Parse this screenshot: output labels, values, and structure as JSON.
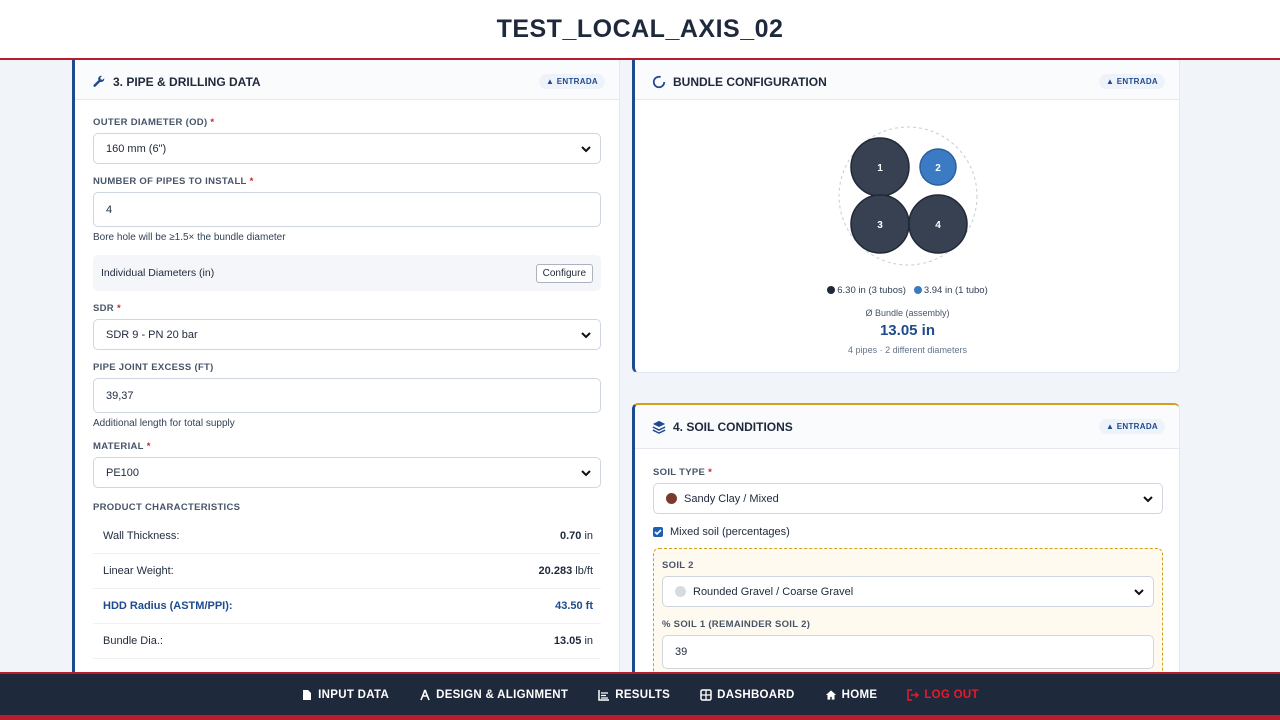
{
  "header": {
    "title": "TEST_LOCAL_AXIS_02"
  },
  "pipe": {
    "title": "3. PIPE & DRILLING DATA",
    "badge": "ENTRADA",
    "od_label": "OUTER DIAMETER (OD)",
    "od_value": "160 mm (6\")",
    "num_label": "NUMBER OF PIPES TO INSTALL",
    "num_value": "4",
    "num_help": "Bore hole will be ≥1.5× the bundle diameter",
    "indiv_label": "Individual Diameters (in)",
    "configure_label": "Configure",
    "sdr_label": "SDR",
    "sdr_value": "SDR 9 - PN 20 bar",
    "joint_label": "PIPE JOINT EXCESS (FT)",
    "joint_value": "39,37",
    "joint_help": "Additional length for total supply",
    "material_label": "MATERIAL",
    "material_value": "PE100",
    "char_title": "PRODUCT CHARACTERISTICS",
    "chars": [
      {
        "label": "Wall Thickness:",
        "value": "0.70",
        "unit": "in",
        "accent": false
      },
      {
        "label": "Linear Weight:",
        "value": "20.283",
        "unit": "lb/ft",
        "accent": false
      },
      {
        "label": "HDD Radius (ASTM/PPI):",
        "value": "43.50",
        "unit": "ft",
        "accent": true
      },
      {
        "label": "Bundle Dia.:",
        "value": "13.05",
        "unit": "in",
        "accent": false
      }
    ]
  },
  "bundle": {
    "title": "BUNDLE CONFIGURATION",
    "badge": "ENTRADA",
    "pipes": [
      "1",
      "2",
      "3",
      "4"
    ],
    "legend_dark": "6.30 in (3 tubos)",
    "legend_blue": "3.94 in (1 tubo)",
    "caption": "Ø Bundle (assembly)",
    "value": "13.05 in",
    "sub": "4 pipes · 2 different diameters",
    "colors": {
      "dark": "#374151",
      "blue": "#3b7bc4"
    }
  },
  "soil": {
    "title": "4. SOIL CONDITIONS",
    "badge": "ENTRADA",
    "type_label": "SOIL TYPE",
    "type_value": "Sandy Clay / Mixed",
    "mixed_label": "Mixed soil (percentages)",
    "soil2_label": "SOIL 2",
    "soil2_value": "Rounded Gravel / Coarse Gravel",
    "pct_label": "% SOIL 1 (REMAINDER SOIL 2)",
    "pct_value": "39"
  },
  "nav": {
    "items": [
      {
        "label": "INPUT DATA",
        "icon": "document-icon"
      },
      {
        "label": "DESIGN & ALIGNMENT",
        "icon": "compass-icon"
      },
      {
        "label": "RESULTS",
        "icon": "list-icon"
      },
      {
        "label": "DASHBOARD",
        "icon": "grid-icon"
      },
      {
        "label": "HOME",
        "icon": "home-icon"
      },
      {
        "label": "LOG OUT",
        "icon": "logout-icon"
      }
    ]
  },
  "theme": {
    "accent": "#1e4a8e",
    "danger": "#b91c2c",
    "warning": "#d4a017",
    "navbar": "#1e293b"
  }
}
